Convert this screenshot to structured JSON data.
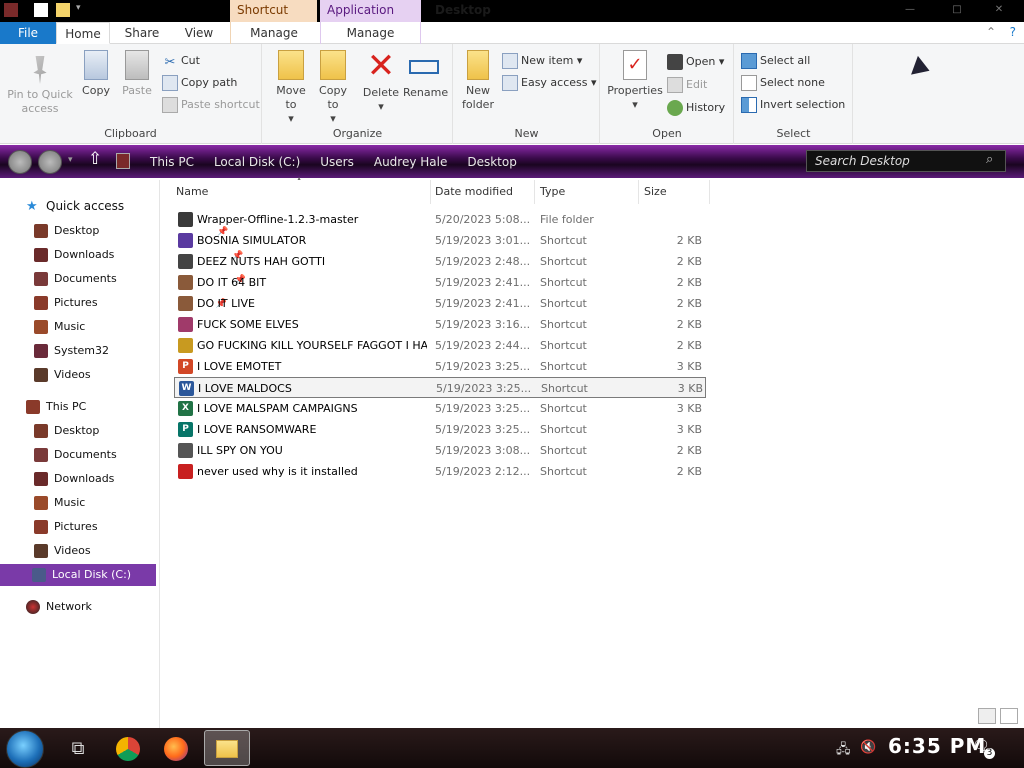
{
  "title_bar": {
    "window_title": "Desktop",
    "contextual_tabs": [
      "Shortcut Tools",
      "Application Tools"
    ],
    "controls": [
      "—",
      "□",
      "✕"
    ]
  },
  "ribbon_tabs": [
    "File",
    "Home",
    "Share",
    "View",
    "Manage",
    "Manage"
  ],
  "ribbon": {
    "clipboard": {
      "label": "Clipboard",
      "pin": "Pin to Quick access",
      "copy": "Copy",
      "paste": "Paste",
      "cut": "Cut",
      "copy_path": "Copy path",
      "paste_shortcut": "Paste shortcut"
    },
    "organize": {
      "label": "Organize",
      "move_to": "Move to",
      "copy_to": "Copy to",
      "delete": "Delete",
      "rename": "Rename"
    },
    "new": {
      "label": "New",
      "new_folder": "New folder",
      "new_item": "New item",
      "easy_access": "Easy access"
    },
    "open": {
      "label": "Open",
      "properties": "Properties",
      "open": "Open",
      "edit": "Edit",
      "history": "History"
    },
    "select": {
      "label": "Select",
      "select_all": "Select all",
      "select_none": "Select none",
      "invert": "Invert selection"
    }
  },
  "address": {
    "breadcrumbs": [
      "This PC",
      "Local Disk (C:)",
      "Users",
      "Audrey Hale",
      "Desktop"
    ],
    "search_placeholder": "Search Desktop"
  },
  "nav": {
    "quick_access": "Quick access",
    "quick_items": [
      "Desktop",
      "Downloads",
      "Documents",
      "Pictures",
      "Music",
      "System32",
      "Videos"
    ],
    "this_pc": "This PC",
    "pc_items": [
      "Desktop",
      "Documents",
      "Downloads",
      "Music",
      "Pictures",
      "Videos",
      "Local Disk (C:)"
    ],
    "network": "Network"
  },
  "columns": [
    "Name",
    "Date modified",
    "Type",
    "Size"
  ],
  "files": [
    {
      "name": "Wrapper-Offline-1.2.3-master",
      "date": "5/20/2023 5:08...",
      "type": "File folder",
      "size": "",
      "icon": "folder-icon",
      "color": "#3a3a3a"
    },
    {
      "name": "BOSNIA SIMULATOR",
      "date": "5/19/2023 3:01...",
      "type": "Shortcut",
      "size": "2 KB",
      "icon": "app-icon",
      "color": "#5a3aa0"
    },
    {
      "name": "DEEZ NUTS HAH GOTTI",
      "date": "5/19/2023 2:48...",
      "type": "Shortcut",
      "size": "2 KB",
      "icon": "app-icon",
      "color": "#444"
    },
    {
      "name": "DO IT 64 BIT",
      "date": "5/19/2023 2:41...",
      "type": "Shortcut",
      "size": "2 KB",
      "icon": "portrait-icon",
      "color": "#8a5a3a"
    },
    {
      "name": "DO IT LIVE",
      "date": "5/19/2023 2:41...",
      "type": "Shortcut",
      "size": "2 KB",
      "icon": "portrait-icon",
      "color": "#8a5a3a"
    },
    {
      "name": "FUCK SOME ELVES",
      "date": "5/19/2023 3:16...",
      "type": "Shortcut",
      "size": "2 KB",
      "icon": "app-icon",
      "color": "#a03a6a"
    },
    {
      "name": "GO FUCKING KILL YOURSELF FAGGOT I HATE...",
      "date": "5/19/2023 2:44...",
      "type": "Shortcut",
      "size": "2 KB",
      "icon": "app-icon",
      "color": "#c89a20"
    },
    {
      "name": "I LOVE EMOTET",
      "date": "5/19/2023 3:25...",
      "type": "Shortcut",
      "size": "3 KB",
      "icon": "powerpoint-icon",
      "color": "#d24726"
    },
    {
      "name": "I LOVE MALDOCS",
      "date": "5/19/2023 3:25...",
      "type": "Shortcut",
      "size": "3 KB",
      "icon": "word-icon",
      "color": "#2b579a",
      "selected": true
    },
    {
      "name": "I LOVE MALSPAM CAMPAIGNS",
      "date": "5/19/2023 3:25...",
      "type": "Shortcut",
      "size": "3 KB",
      "icon": "excel-icon",
      "color": "#217346"
    },
    {
      "name": "I LOVE RANSOMWARE",
      "date": "5/19/2023 3:25...",
      "type": "Shortcut",
      "size": "3 KB",
      "icon": "publisher-icon",
      "color": "#077568"
    },
    {
      "name": "ILL SPY ON YOU",
      "date": "5/19/2023 3:08...",
      "type": "Shortcut",
      "size": "2 KB",
      "icon": "app-icon",
      "color": "#555"
    },
    {
      "name": "never used why is it installed",
      "date": "5/19/2023 2:12...",
      "type": "Shortcut",
      "size": "2 KB",
      "icon": "app-icon",
      "color": "#c82020"
    }
  ],
  "taskbar": {
    "clock": "6:35 PM",
    "notification_count": "3"
  }
}
